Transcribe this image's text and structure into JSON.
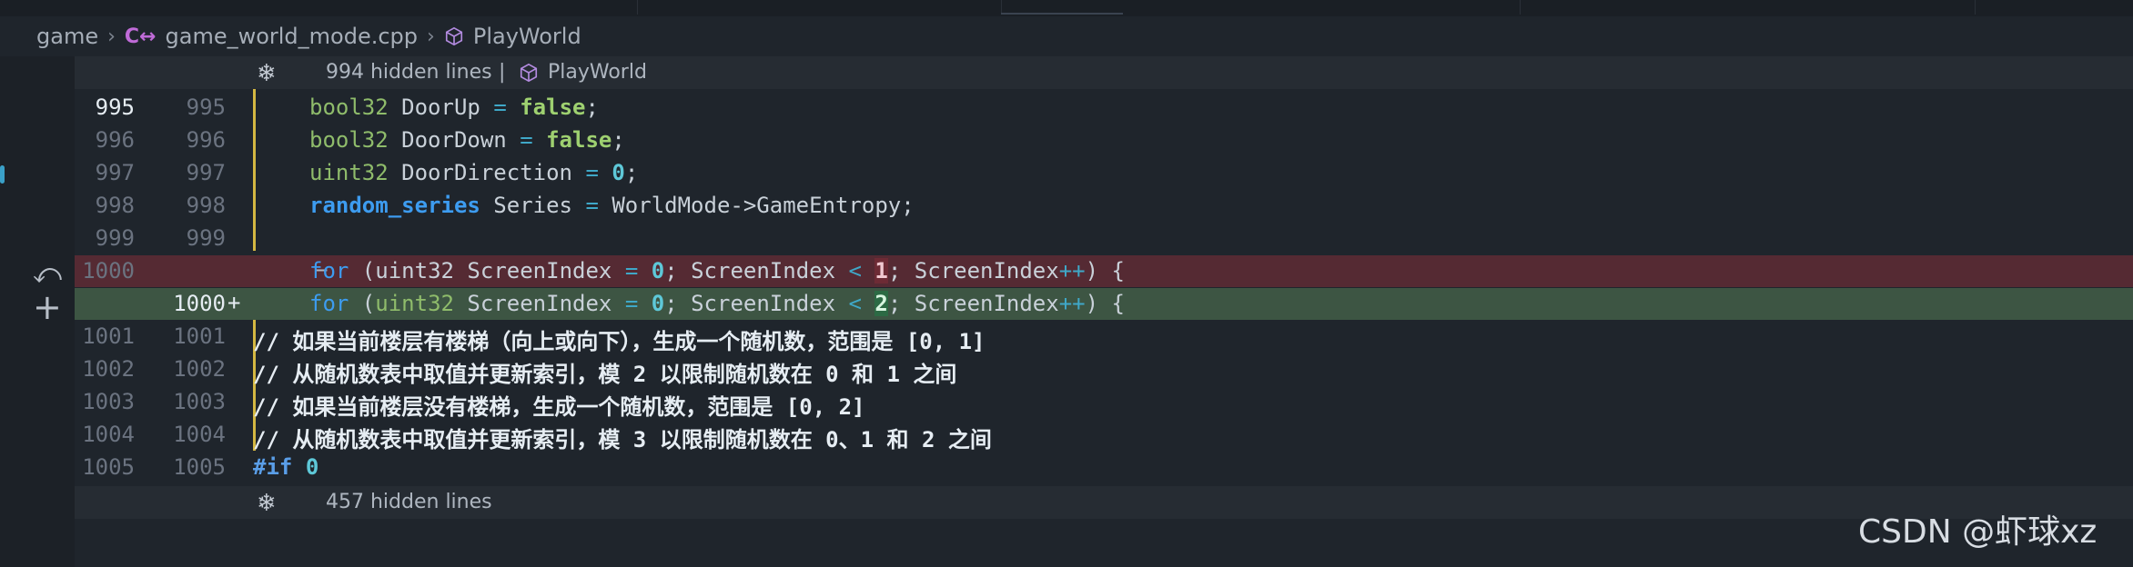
{
  "breadcrumb": {
    "folder": "game",
    "file": "game_world_mode.cpp",
    "symbol": "PlayWorld",
    "file_icon": "c++-icon",
    "symbol_icon": "cube-icon"
  },
  "hidden_top": {
    "text": "994 hidden lines",
    "separator": "|",
    "symbol": "PlayWorld"
  },
  "hidden_bottom": {
    "text": "457 hidden lines"
  },
  "lines": {
    "l995": {
      "a": "995",
      "b": "995"
    },
    "l996": {
      "a": "996",
      "b": "996"
    },
    "l997": {
      "a": "997",
      "b": "997"
    },
    "l998": {
      "a": "998",
      "b": "998"
    },
    "l999": {
      "a": "999",
      "b": "999"
    },
    "l1000del": {
      "a": "1000",
      "marker": "−"
    },
    "l1000add": {
      "b": "1000",
      "marker": "+"
    },
    "l1001": {
      "a": "1001",
      "b": "1001",
      "code": "// 如果当前楼层有楼梯（向上或向下），生成一个随机数，范围是 [0, 1]"
    },
    "l1002": {
      "a": "1002",
      "b": "1002",
      "code": "// 从随机数表中取值并更新索引，模 2 以限制随机数在 0 和 1 之间"
    },
    "l1003": {
      "a": "1003",
      "b": "1003",
      "code": "// 如果当前楼层没有楼梯，生成一个随机数，范围是 [0, 2]"
    },
    "l1004": {
      "a": "1004",
      "b": "1004",
      "code": "// 从随机数表中取值并更新索引，模 3 以限制随机数在 0、1 和 2 之间"
    },
    "l1005": {
      "a": "1005",
      "b": "1005"
    }
  },
  "tokens": {
    "bool32": "bool32",
    "uint32": "uint32",
    "random_series": "random_series",
    "false": "false",
    "zero": "0",
    "eq": "=",
    "semi": ";",
    "door_up": "DoorUp",
    "door_down": "DoorDown",
    "door_direction": "DoorDirection",
    "series": "Series",
    "entropy": "WorldMode->GameEntropy;",
    "for": "for",
    "screen_index": "ScreenIndex",
    "lt": "<",
    "inc": "++",
    "one": "1",
    "two": "2",
    "if_directive": "#if",
    "if_value": "0"
  },
  "watermark": "CSDN @虾球xz"
}
